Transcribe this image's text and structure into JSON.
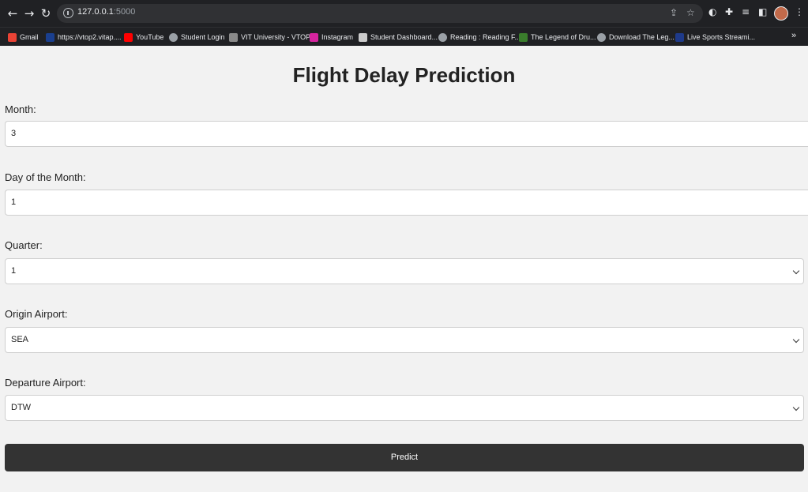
{
  "browser": {
    "url_host": "127.0.0.1",
    "url_port": ":5000",
    "bookmarks": [
      {
        "label": "Gmail",
        "color": "#ea4335"
      },
      {
        "label": "https://vtop2.vitap....",
        "color": "#1a3f8f"
      },
      {
        "label": "YouTube",
        "color": "#ff0000"
      },
      {
        "label": "Student Login",
        "color": "#9aa0a6"
      },
      {
        "label": "VIT University - VTOP",
        "color": "#8a8a8a"
      },
      {
        "label": "Instagram",
        "color": "#d6249f"
      },
      {
        "label": "Student Dashboard...",
        "color": "#cccccc"
      },
      {
        "label": "Reading : Reading F...",
        "color": "#9aa0a6"
      },
      {
        "label": "The Legend of Dru...",
        "color": "#3a7d2c"
      },
      {
        "label": "Download The Leg...",
        "color": "#9aa0a6"
      },
      {
        "label": "Live Sports Streami...",
        "color": "#1e3a8a"
      }
    ],
    "more": "»"
  },
  "page": {
    "title": "Flight Delay Prediction",
    "month": {
      "label": "Month:",
      "value": "3"
    },
    "day": {
      "label": "Day of the Month:",
      "value": "1"
    },
    "quarter": {
      "label": "Quarter:",
      "value": "1"
    },
    "origin": {
      "label": "Origin Airport:",
      "value": "SEA"
    },
    "departure": {
      "label": "Departure Airport:",
      "value": "DTW"
    },
    "predict_label": "Predict"
  }
}
